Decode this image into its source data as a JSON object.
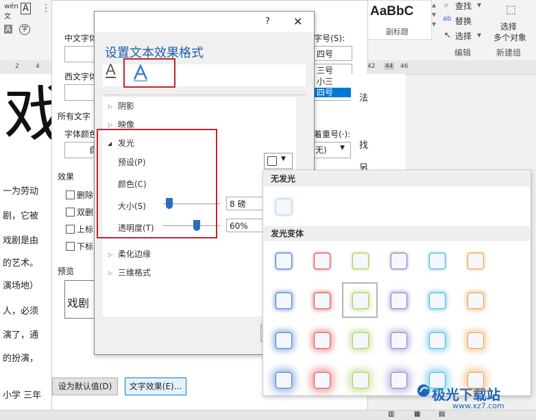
{
  "ribbon": {
    "style_preview": "AaBbC",
    "style_name": "副标题",
    "find_label": "查找",
    "replace_label": "替换",
    "select_label": "选择",
    "edit_group_label": "编辑",
    "select_objects_label_1": "选择",
    "select_objects_label_2": "多个对象",
    "new_group_label": "新建组"
  },
  "ruler": {
    "ticks": [
      "2",
      "4",
      "42",
      "44",
      "46"
    ]
  },
  "document": {
    "big_char": "戏",
    "left_lines": [
      "一为劳动",
      "剧，它被",
      "戏剧是由",
      "的艺术。",
      "演场地）",
      "人，必须",
      "演了，通",
      "的扮演，",
      "小学 三年"
    ],
    "right_lines": [
      "法",
      "找",
      "另"
    ]
  },
  "font_dialog": {
    "chinese_font_label": "中文字体",
    "western_font_label": "西文字体",
    "all_text_label": "所有文字",
    "font_color_label": "字体颜色",
    "font_color_value": "自",
    "effects_label": "效果",
    "effects": [
      "删除",
      "双删",
      "上标",
      "下标"
    ],
    "preview_label": "预览",
    "preview_text": "戏剧",
    "size_label": "字号(S):",
    "size_value": "四号",
    "size_list": [
      "三号",
      "小三",
      "四号"
    ],
    "emphasis_label": "着重号(·):",
    "emphasis_value": "无)",
    "set_default_button": "设为默认值(D)",
    "text_effects_button": "文字效果(E)..."
  },
  "effects_dialog": {
    "help": "?",
    "close": "✕",
    "heading": "设置文本效果格式",
    "tabs": [
      "text-fill-outline",
      "text-effects"
    ],
    "sections": {
      "shadow": "阴影",
      "reflection": "映像",
      "glow": "发光",
      "soft_edges": "柔化边缘",
      "format_3d": "三维格式"
    },
    "glow_props": {
      "preset": "预设(P)",
      "color": "颜色(C)",
      "size": "大小(S)",
      "transparency": "透明度(T)",
      "size_value": "8 磅",
      "transparency_value": "60%",
      "size_fraction": 0.05,
      "transparency_fraction": 0.6
    }
  },
  "glow_gallery": {
    "no_glow_label": "无发光",
    "variants_label": "发光变体",
    "colors": [
      "#4a7bd4",
      "#e05050",
      "#a8cf5a",
      "#9a78c9",
      "#46b8e0",
      "#f0a050"
    ],
    "rows": 4,
    "selected_row": 1,
    "selected_col": 2
  },
  "watermark": {
    "brand": "极光下载站",
    "url": "www.xz7.com"
  }
}
